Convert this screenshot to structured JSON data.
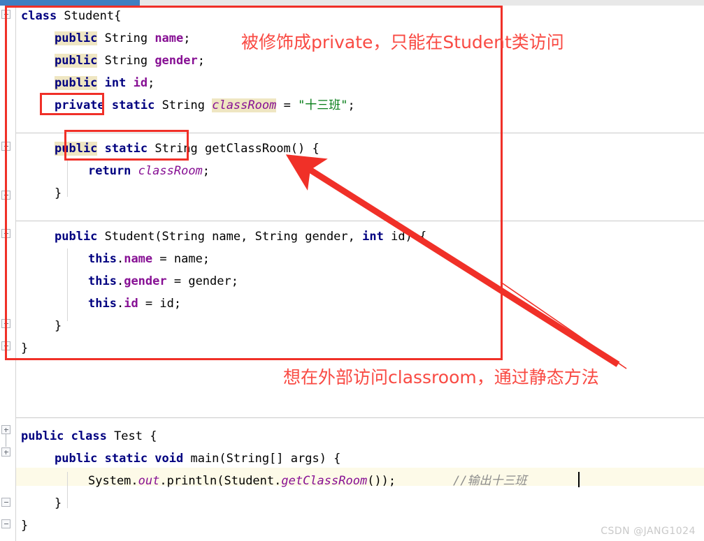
{
  "window": {
    "scrollbar_label": "horizontal-scrollbar"
  },
  "editor": {
    "top_class_code": [
      {
        "indent": 0,
        "tokens": [
          {
            "t": "class ",
            "c": "kw"
          },
          {
            "t": "Student{",
            "c": "pln"
          }
        ]
      },
      {
        "indent": 1,
        "tokens": [
          {
            "t": "public",
            "c": "kw hl"
          },
          {
            "t": " String ",
            "c": "pln"
          },
          {
            "t": "name",
            "c": "fld"
          },
          {
            "t": ";",
            "c": "pln"
          }
        ]
      },
      {
        "indent": 1,
        "tokens": [
          {
            "t": "public",
            "c": "kw hl"
          },
          {
            "t": " String ",
            "c": "pln"
          },
          {
            "t": "gender",
            "c": "fld"
          },
          {
            "t": ";",
            "c": "pln"
          }
        ]
      },
      {
        "indent": 1,
        "tokens": [
          {
            "t": "public",
            "c": "kw hl"
          },
          {
            "t": " ",
            "c": "pln"
          },
          {
            "t": "int",
            "c": "kw"
          },
          {
            "t": " ",
            "c": "pln"
          },
          {
            "t": "id",
            "c": "fld"
          },
          {
            "t": ";",
            "c": "pln"
          }
        ]
      },
      {
        "indent": 1,
        "tokens": [
          {
            "t": "private",
            "c": "kw"
          },
          {
            "t": " ",
            "c": "pln"
          },
          {
            "t": "static",
            "c": "kw"
          },
          {
            "t": " String ",
            "c": "pln"
          },
          {
            "t": "classRoom",
            "c": "stat hl"
          },
          {
            "t": " = ",
            "c": "pln"
          },
          {
            "t": "\"十三班\"",
            "c": "str"
          },
          {
            "t": ";",
            "c": "pln"
          }
        ]
      },
      {
        "indent": 1,
        "tokens": [
          {
            "t": "public",
            "c": "kw hl"
          },
          {
            "t": " ",
            "c": "pln"
          },
          {
            "t": "static",
            "c": "kw"
          },
          {
            "t": " String getClassRoom() {",
            "c": "pln"
          }
        ]
      },
      {
        "indent": 2,
        "tokens": [
          {
            "t": "return",
            "c": "kw"
          },
          {
            "t": " ",
            "c": "pln"
          },
          {
            "t": "classRoom",
            "c": "stat"
          },
          {
            "t": ";",
            "c": "pln"
          }
        ]
      },
      {
        "indent": 1,
        "tokens": [
          {
            "t": "}",
            "c": "pln"
          }
        ]
      },
      {
        "indent": 1,
        "tokens": [
          {
            "t": "public",
            "c": "kw"
          },
          {
            "t": " Student(String name, String gender, ",
            "c": "pln"
          },
          {
            "t": "int",
            "c": "kw"
          },
          {
            "t": " id) {",
            "c": "pln"
          }
        ]
      },
      {
        "indent": 2,
        "tokens": [
          {
            "t": "this",
            "c": "kw"
          },
          {
            "t": ".",
            "c": "pln"
          },
          {
            "t": "name",
            "c": "fld"
          },
          {
            "t": " = name;",
            "c": "pln"
          }
        ]
      },
      {
        "indent": 2,
        "tokens": [
          {
            "t": "this",
            "c": "kw"
          },
          {
            "t": ".",
            "c": "pln"
          },
          {
            "t": "gender",
            "c": "fld"
          },
          {
            "t": " = gender;",
            "c": "pln"
          }
        ]
      },
      {
        "indent": 2,
        "tokens": [
          {
            "t": "this",
            "c": "kw"
          },
          {
            "t": ".",
            "c": "pln"
          },
          {
            "t": "id",
            "c": "fld"
          },
          {
            "t": " = id;",
            "c": "pln"
          }
        ]
      },
      {
        "indent": 1,
        "tokens": [
          {
            "t": "}",
            "c": "pln"
          }
        ]
      },
      {
        "indent": 0,
        "tokens": [
          {
            "t": "}",
            "c": "pln"
          }
        ]
      }
    ],
    "test_class_code": [
      {
        "indent": 0,
        "tokens": [
          {
            "t": "public class ",
            "c": "kw"
          },
          {
            "t": "Test {",
            "c": "pln"
          }
        ]
      },
      {
        "indent": 1,
        "tokens": [
          {
            "t": "public static void ",
            "c": "kw"
          },
          {
            "t": "main(String[] args) {",
            "c": "pln"
          }
        ]
      },
      {
        "indent": 2,
        "tokens": [
          {
            "t": "System.",
            "c": "pln"
          },
          {
            "t": "out",
            "c": "stat"
          },
          {
            "t": ".println(Student.",
            "c": "pln"
          },
          {
            "t": "getClassRoom",
            "c": "stat"
          },
          {
            "t": "());",
            "c": "pln"
          },
          {
            "t": "        ",
            "c": "pln"
          },
          {
            "t": "//输出十三班",
            "c": "cmt"
          }
        ]
      },
      {
        "indent": 1,
        "tokens": [
          {
            "t": "}",
            "c": "pln"
          }
        ]
      },
      {
        "indent": 0,
        "tokens": [
          {
            "t": "}",
            "c": "pln"
          }
        ]
      }
    ]
  },
  "annotations": {
    "color": "#f94a43",
    "note_private": "被修饰成private，只能在Student类访问",
    "note_static_method": "想在外部访问classroom，通过静态方法",
    "box_private_label": "private",
    "box_static_label": "public static String"
  },
  "watermark": {
    "text": "CSDN @JANG1024"
  }
}
